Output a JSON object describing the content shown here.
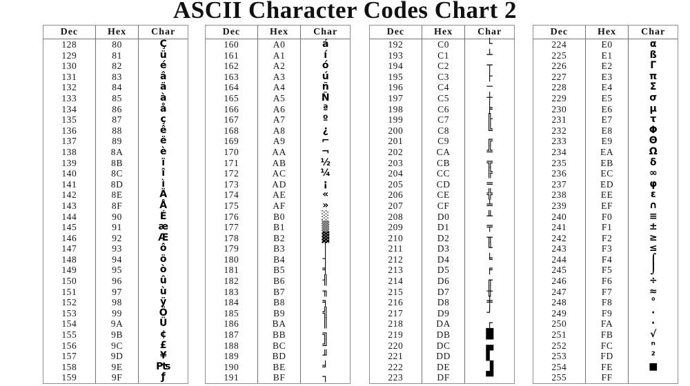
{
  "title": "ASCII Character Codes Chart 2",
  "columns": {
    "dec": "Dec",
    "hex": "Hex",
    "char": "Char"
  },
  "tables": [
    {
      "name": "table-128-159",
      "rows": [
        {
          "dec": "128",
          "hex": "80",
          "char": "Ç"
        },
        {
          "dec": "129",
          "hex": "81",
          "char": "ü"
        },
        {
          "dec": "130",
          "hex": "82",
          "char": "é"
        },
        {
          "dec": "131",
          "hex": "83",
          "char": "â"
        },
        {
          "dec": "132",
          "hex": "84",
          "char": "ä"
        },
        {
          "dec": "133",
          "hex": "85",
          "char": "à"
        },
        {
          "dec": "134",
          "hex": "86",
          "char": "å"
        },
        {
          "dec": "135",
          "hex": "87",
          "char": "ç"
        },
        {
          "dec": "136",
          "hex": "88",
          "char": "ê"
        },
        {
          "dec": "137",
          "hex": "89",
          "char": "ë"
        },
        {
          "dec": "138",
          "hex": "8A",
          "char": "è"
        },
        {
          "dec": "139",
          "hex": "8B",
          "char": "ï"
        },
        {
          "dec": "140",
          "hex": "8C",
          "char": "î"
        },
        {
          "dec": "141",
          "hex": "8D",
          "char": "ì"
        },
        {
          "dec": "142",
          "hex": "8E",
          "char": "Ä"
        },
        {
          "dec": "143",
          "hex": "8F",
          "char": "Å"
        },
        {
          "dec": "144",
          "hex": "90",
          "char": "É"
        },
        {
          "dec": "145",
          "hex": "91",
          "char": "æ"
        },
        {
          "dec": "146",
          "hex": "92",
          "char": "Æ"
        },
        {
          "dec": "147",
          "hex": "93",
          "char": "ô"
        },
        {
          "dec": "148",
          "hex": "94",
          "char": "ö"
        },
        {
          "dec": "149",
          "hex": "95",
          "char": "ò"
        },
        {
          "dec": "150",
          "hex": "96",
          "char": "û"
        },
        {
          "dec": "151",
          "hex": "97",
          "char": "ù"
        },
        {
          "dec": "152",
          "hex": "98",
          "char": "ÿ"
        },
        {
          "dec": "153",
          "hex": "99",
          "char": "Ö"
        },
        {
          "dec": "154",
          "hex": "9A",
          "char": "Ü"
        },
        {
          "dec": "155",
          "hex": "9B",
          "char": "¢"
        },
        {
          "dec": "156",
          "hex": "9C",
          "char": "£"
        },
        {
          "dec": "157",
          "hex": "9D",
          "char": "¥"
        },
        {
          "dec": "158",
          "hex": "9E",
          "char": "₧"
        },
        {
          "dec": "159",
          "hex": "9F",
          "char": "ƒ"
        }
      ]
    },
    {
      "name": "table-160-191",
      "rows": [
        {
          "dec": "160",
          "hex": "A0",
          "char": "á"
        },
        {
          "dec": "161",
          "hex": "A1",
          "char": "í"
        },
        {
          "dec": "162",
          "hex": "A2",
          "char": "ó"
        },
        {
          "dec": "163",
          "hex": "A3",
          "char": "ú"
        },
        {
          "dec": "164",
          "hex": "A4",
          "char": "ñ"
        },
        {
          "dec": "165",
          "hex": "A5",
          "char": "Ñ"
        },
        {
          "dec": "166",
          "hex": "A6",
          "char": "ª"
        },
        {
          "dec": "167",
          "hex": "A7",
          "char": "º"
        },
        {
          "dec": "168",
          "hex": "A8",
          "char": "¿"
        },
        {
          "dec": "169",
          "hex": "A9",
          "char": "⌐"
        },
        {
          "dec": "170",
          "hex": "AA",
          "char": "¬"
        },
        {
          "dec": "171",
          "hex": "AB",
          "char": "½"
        },
        {
          "dec": "172",
          "hex": "AC",
          "char": "¼"
        },
        {
          "dec": "173",
          "hex": "AD",
          "char": "¡"
        },
        {
          "dec": "174",
          "hex": "AE",
          "char": "«"
        },
        {
          "dec": "175",
          "hex": "AF",
          "char": "»"
        },
        {
          "dec": "176",
          "hex": "B0",
          "char": "░"
        },
        {
          "dec": "177",
          "hex": "B1",
          "char": "▒"
        },
        {
          "dec": "178",
          "hex": "B2",
          "char": "▓"
        },
        {
          "dec": "179",
          "hex": "B3",
          "char": "│"
        },
        {
          "dec": "180",
          "hex": "B4",
          "char": "┤"
        },
        {
          "dec": "181",
          "hex": "B5",
          "char": "╡"
        },
        {
          "dec": "182",
          "hex": "B6",
          "char": "╢"
        },
        {
          "dec": "183",
          "hex": "B7",
          "char": "╖"
        },
        {
          "dec": "184",
          "hex": "B8",
          "char": "╕"
        },
        {
          "dec": "185",
          "hex": "B9",
          "char": "╣"
        },
        {
          "dec": "186",
          "hex": "BA",
          "char": "║"
        },
        {
          "dec": "187",
          "hex": "BB",
          "char": "╗"
        },
        {
          "dec": "188",
          "hex": "BC",
          "char": "╝"
        },
        {
          "dec": "189",
          "hex": "BD",
          "char": "╜"
        },
        {
          "dec": "190",
          "hex": "BE",
          "char": "╛"
        },
        {
          "dec": "191",
          "hex": "BF",
          "char": "┐"
        }
      ]
    },
    {
      "name": "table-192-223",
      "rows": [
        {
          "dec": "192",
          "hex": "C0",
          "char": "└"
        },
        {
          "dec": "193",
          "hex": "C1",
          "char": "┴"
        },
        {
          "dec": "194",
          "hex": "C2",
          "char": "┬"
        },
        {
          "dec": "195",
          "hex": "C3",
          "char": "├"
        },
        {
          "dec": "196",
          "hex": "C4",
          "char": "─"
        },
        {
          "dec": "197",
          "hex": "C5",
          "char": "┼"
        },
        {
          "dec": "198",
          "hex": "C6",
          "char": "╞"
        },
        {
          "dec": "199",
          "hex": "C7",
          "char": "╟"
        },
        {
          "dec": "200",
          "hex": "C8",
          "char": "╚"
        },
        {
          "dec": "201",
          "hex": "C9",
          "char": "╔"
        },
        {
          "dec": "202",
          "hex": "CA",
          "char": "╩"
        },
        {
          "dec": "203",
          "hex": "CB",
          "char": "╦"
        },
        {
          "dec": "204",
          "hex": "CC",
          "char": "╠"
        },
        {
          "dec": "205",
          "hex": "CD",
          "char": "═"
        },
        {
          "dec": "206",
          "hex": "CE",
          "char": "╬"
        },
        {
          "dec": "207",
          "hex": "CF",
          "char": "╧"
        },
        {
          "dec": "208",
          "hex": "D0",
          "char": "╨"
        },
        {
          "dec": "209",
          "hex": "D1",
          "char": "╤"
        },
        {
          "dec": "210",
          "hex": "D2",
          "char": "╥"
        },
        {
          "dec": "211",
          "hex": "D3",
          "char": "╙"
        },
        {
          "dec": "212",
          "hex": "D4",
          "char": "╘"
        },
        {
          "dec": "213",
          "hex": "D5",
          "char": "╒"
        },
        {
          "dec": "214",
          "hex": "D6",
          "char": "╓"
        },
        {
          "dec": "215",
          "hex": "D7",
          "char": "╫"
        },
        {
          "dec": "216",
          "hex": "D8",
          "char": "╪"
        },
        {
          "dec": "217",
          "hex": "D9",
          "char": "┘"
        },
        {
          "dec": "218",
          "hex": "DA",
          "char": "┌"
        },
        {
          "dec": "219",
          "hex": "DB",
          "char": "█"
        },
        {
          "dec": "220",
          "hex": "DC",
          "char": "▄"
        },
        {
          "dec": "221",
          "hex": "DD",
          "char": "▌"
        },
        {
          "dec": "222",
          "hex": "DE",
          "char": "▐"
        },
        {
          "dec": "223",
          "hex": "DF",
          "char": "▀"
        }
      ]
    },
    {
      "name": "table-224-255",
      "rows": [
        {
          "dec": "224",
          "hex": "E0",
          "char": "α"
        },
        {
          "dec": "225",
          "hex": "E1",
          "char": "ß"
        },
        {
          "dec": "226",
          "hex": "E2",
          "char": "Γ"
        },
        {
          "dec": "227",
          "hex": "E3",
          "char": "π"
        },
        {
          "dec": "228",
          "hex": "E4",
          "char": "Σ"
        },
        {
          "dec": "229",
          "hex": "E5",
          "char": "σ"
        },
        {
          "dec": "230",
          "hex": "E6",
          "char": "µ"
        },
        {
          "dec": "231",
          "hex": "E7",
          "char": "τ"
        },
        {
          "dec": "232",
          "hex": "E8",
          "char": "Φ"
        },
        {
          "dec": "233",
          "hex": "E9",
          "char": "Θ"
        },
        {
          "dec": "234",
          "hex": "EA",
          "char": "Ω"
        },
        {
          "dec": "235",
          "hex": "EB",
          "char": "δ"
        },
        {
          "dec": "236",
          "hex": "EC",
          "char": "∞"
        },
        {
          "dec": "237",
          "hex": "ED",
          "char": "φ"
        },
        {
          "dec": "238",
          "hex": "EE",
          "char": "ε"
        },
        {
          "dec": "239",
          "hex": "EF",
          "char": "∩"
        },
        {
          "dec": "240",
          "hex": "F0",
          "char": "≡"
        },
        {
          "dec": "241",
          "hex": "F1",
          "char": "±"
        },
        {
          "dec": "242",
          "hex": "F2",
          "char": "≥"
        },
        {
          "dec": "243",
          "hex": "F3",
          "char": "≤"
        },
        {
          "dec": "244",
          "hex": "F4",
          "char": "⌠"
        },
        {
          "dec": "245",
          "hex": "F5",
          "char": "⌡"
        },
        {
          "dec": "246",
          "hex": "F6",
          "char": "÷"
        },
        {
          "dec": "247",
          "hex": "F7",
          "char": "≈"
        },
        {
          "dec": "248",
          "hex": "F8",
          "char": "°"
        },
        {
          "dec": "249",
          "hex": "F9",
          "char": "∙"
        },
        {
          "dec": "250",
          "hex": "FA",
          "char": "·"
        },
        {
          "dec": "251",
          "hex": "FB",
          "char": "√"
        },
        {
          "dec": "252",
          "hex": "FC",
          "char": "ⁿ"
        },
        {
          "dec": "253",
          "hex": "FD",
          "char": "²"
        },
        {
          "dec": "254",
          "hex": "FE",
          "char": "■"
        },
        {
          "dec": "255",
          "hex": "FF",
          "char": " "
        }
      ]
    }
  ],
  "colors": {
    "page_background": "#ffffff",
    "text": "#111111",
    "table_border": "#8d8d8d",
    "rule": "#6f6f6f"
  }
}
